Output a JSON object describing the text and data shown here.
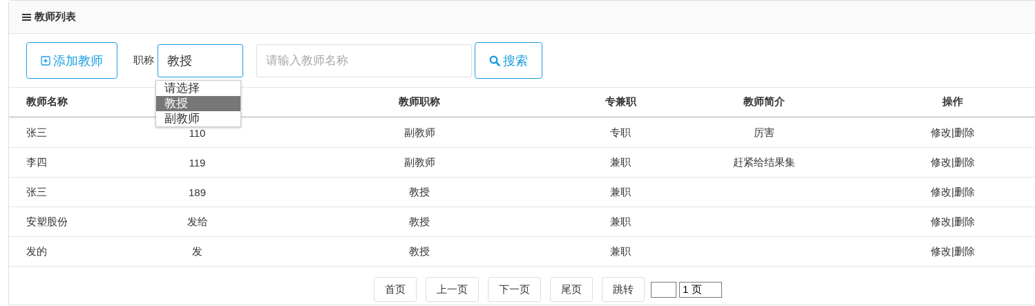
{
  "panel": {
    "title": "教师列表"
  },
  "toolbar": {
    "add_button": "添加教师",
    "filter_label": "职称",
    "select_value": "教授",
    "search_placeholder": "请输入教师名称",
    "search_button": "搜索",
    "dropdown": [
      {
        "label": "请选择",
        "selected": false
      },
      {
        "label": "教授",
        "selected": true
      },
      {
        "label": "副教师",
        "selected": false
      }
    ]
  },
  "table": {
    "columns": [
      "教师名称",
      null,
      "教师职称",
      "专兼职",
      "教师简介",
      "操作"
    ],
    "action_separator": "|",
    "rows": [
      {
        "cells": [
          "张三",
          "110",
          "副教师",
          "专职",
          "厉害"
        ],
        "actions": [
          "修改",
          "删除"
        ]
      },
      {
        "cells": [
          "李四",
          "119",
          "副教师",
          "兼职",
          "赶紧给结果集"
        ],
        "actions": [
          "修改",
          "删除"
        ]
      },
      {
        "cells": [
          "张三",
          "189",
          "教授",
          "兼职",
          ""
        ],
        "actions": [
          "修改",
          "删除"
        ]
      },
      {
        "cells": [
          "安塑股份",
          "发给",
          "教授",
          "兼职",
          ""
        ],
        "actions": [
          "修改",
          "删除"
        ]
      },
      {
        "cells": [
          "发的",
          "发",
          "教授",
          "兼职",
          ""
        ],
        "actions": [
          "修改",
          "删除"
        ]
      }
    ]
  },
  "pagination": {
    "buttons": [
      "首页",
      "上一页",
      "下一页",
      "尾页",
      "跳转"
    ],
    "page_value": "1 页"
  }
}
